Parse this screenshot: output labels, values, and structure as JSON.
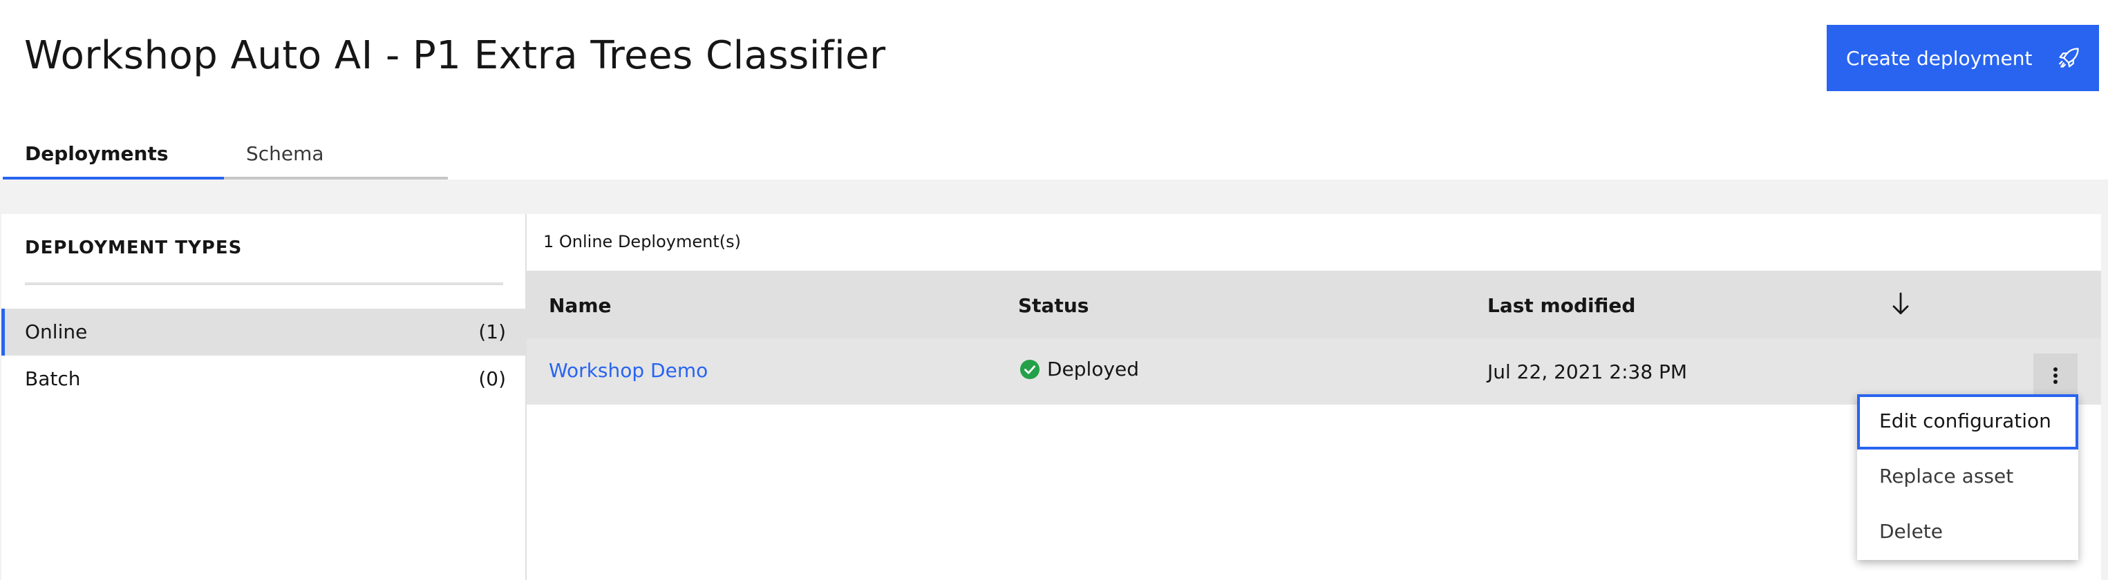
{
  "page": {
    "title": "Workshop Auto AI - P1 Extra Trees Classifier",
    "create_button_label": "Create deployment"
  },
  "tabs": [
    {
      "label": "Deployments",
      "active": true
    },
    {
      "label": "Schema",
      "active": false
    }
  ],
  "deployment_types": {
    "header": "DEPLOYMENT TYPES",
    "items": [
      {
        "label": "Online",
        "count": "(1)",
        "active": true
      },
      {
        "label": "Batch",
        "count": "(0)",
        "active": false
      }
    ]
  },
  "deployments": {
    "caption": "1 Online Deployment(s)",
    "columns": [
      "Name",
      "Status",
      "Last modified"
    ],
    "rows": [
      {
        "name": "Workshop Demo",
        "status": "Deployed",
        "last_modified": "Jul 22, 2021 2:38 PM"
      }
    ]
  },
  "overflow_menu": {
    "items": [
      "Edit configuration",
      "Replace asset",
      "Delete"
    ]
  },
  "colors": {
    "accent": "#2864f0",
    "success": "#24a148"
  },
  "icons": {
    "create_button": "rocket-icon",
    "sort": "arrow-down-icon",
    "status": "checkmark-filled-icon",
    "overflow": "overflow-menu-vertical-icon"
  }
}
